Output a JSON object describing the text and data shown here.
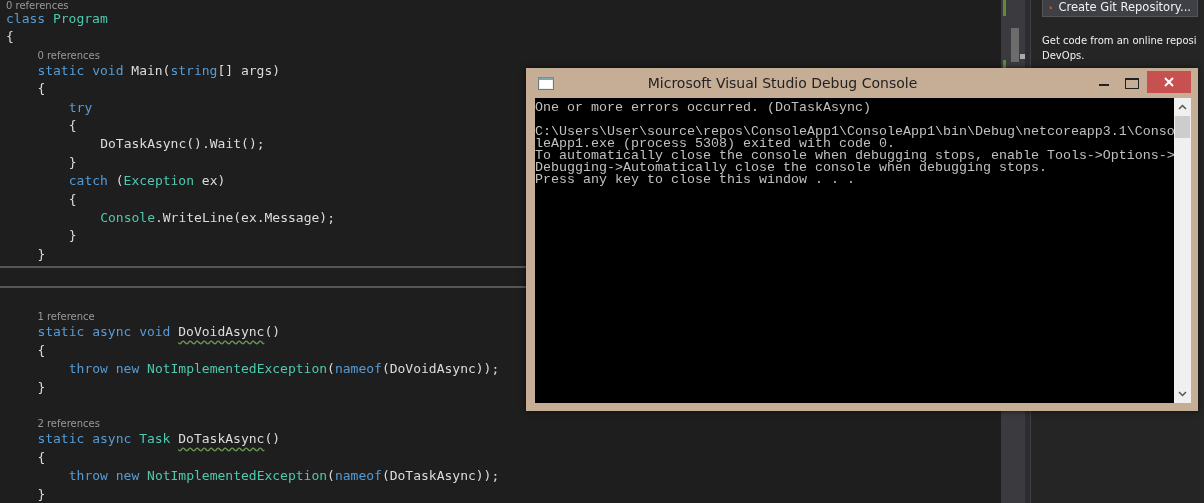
{
  "editor": {
    "lines": [
      {
        "kind": "lens",
        "text": "0 references"
      },
      {
        "kind": "code",
        "tokens": [
          {
            "kind": "kw",
            "text": "class "
          },
          {
            "kind": "type",
            "text": "Program"
          }
        ]
      },
      {
        "kind": "code",
        "tokens": [
          {
            "kind": "plain",
            "text": "{"
          }
        ]
      },
      {
        "kind": "block",
        "children": [
          {
            "kind": "lens",
            "text": "0 references"
          },
          {
            "kind": "code",
            "tokens": [
              {
                "kind": "kw",
                "text": "static void "
              },
              {
                "kind": "plain",
                "text": "Main("
              },
              {
                "kind": "kw",
                "text": "string"
              },
              {
                "kind": "plain",
                "text": "[] args)"
              }
            ]
          },
          {
            "kind": "code",
            "tokens": [
              {
                "kind": "plain",
                "text": "{"
              }
            ]
          },
          {
            "kind": "block",
            "children": [
              {
                "kind": "code",
                "tokens": [
                  {
                    "kind": "kw",
                    "text": "try"
                  }
                ]
              },
              {
                "kind": "code",
                "tokens": [
                  {
                    "kind": "plain",
                    "text": "{"
                  }
                ]
              },
              {
                "kind": "block",
                "children": [
                  {
                    "kind": "code",
                    "tokens": [
                      {
                        "kind": "plain",
                        "text": "DoTaskAsync().Wait();"
                      }
                    ]
                  }
                ]
              },
              {
                "kind": "code",
                "tokens": [
                  {
                    "kind": "plain",
                    "text": "}"
                  }
                ]
              },
              {
                "kind": "code",
                "tokens": [
                  {
                    "kind": "kw",
                    "text": "catch "
                  },
                  {
                    "kind": "plain",
                    "text": "("
                  },
                  {
                    "kind": "type",
                    "text": "Exception"
                  },
                  {
                    "kind": "plain",
                    "text": " ex)"
                  }
                ]
              },
              {
                "kind": "code",
                "tokens": [
                  {
                    "kind": "plain",
                    "text": "{"
                  }
                ]
              },
              {
                "kind": "block",
                "children": [
                  {
                    "kind": "code",
                    "tokens": [
                      {
                        "kind": "type",
                        "text": "Console"
                      },
                      {
                        "kind": "plain",
                        "text": ".WriteLine(ex.Message);"
                      }
                    ]
                  }
                ]
              },
              {
                "kind": "code",
                "tokens": [
                  {
                    "kind": "plain",
                    "text": "}"
                  }
                ]
              }
            ]
          },
          {
            "kind": "code",
            "tokens": [
              {
                "kind": "plain",
                "text": "}"
              }
            ]
          }
        ]
      },
      {
        "kind": "splitter"
      },
      {
        "kind": "blank"
      },
      {
        "kind": "block",
        "children": [
          {
            "kind": "lens",
            "text": "1 reference"
          },
          {
            "kind": "code",
            "tokens": [
              {
                "kind": "kw",
                "text": "static async void "
              },
              {
                "kind": "warn",
                "text": "DoVoidAsync"
              },
              {
                "kind": "plain",
                "text": "()"
              }
            ]
          },
          {
            "kind": "code",
            "tokens": [
              {
                "kind": "plain",
                "text": "{"
              }
            ]
          },
          {
            "kind": "block",
            "children": [
              {
                "kind": "code",
                "tokens": [
                  {
                    "kind": "kw",
                    "text": "throw new "
                  },
                  {
                    "kind": "type",
                    "text": "NotImplementedException"
                  },
                  {
                    "kind": "plain",
                    "text": "("
                  },
                  {
                    "kind": "kw",
                    "text": "nameof"
                  },
                  {
                    "kind": "plain",
                    "text": "(DoVoidAsync));"
                  }
                ]
              }
            ]
          },
          {
            "kind": "code",
            "tokens": [
              {
                "kind": "plain",
                "text": "}"
              }
            ]
          },
          {
            "kind": "blank"
          },
          {
            "kind": "lens",
            "text": "2 references"
          },
          {
            "kind": "code",
            "tokens": [
              {
                "kind": "kw",
                "text": "static async "
              },
              {
                "kind": "type",
                "text": "Task "
              },
              {
                "kind": "warn",
                "text": "DoTaskAsync"
              },
              {
                "kind": "plain",
                "text": "()"
              }
            ]
          },
          {
            "kind": "code",
            "tokens": [
              {
                "kind": "plain",
                "text": "{"
              }
            ]
          },
          {
            "kind": "block",
            "children": [
              {
                "kind": "code",
                "tokens": [
                  {
                    "kind": "kw",
                    "text": "throw new "
                  },
                  {
                    "kind": "type",
                    "text": "NotImplementedException"
                  },
                  {
                    "kind": "plain",
                    "text": "("
                  },
                  {
                    "kind": "kw",
                    "text": "nameof"
                  },
                  {
                    "kind": "plain",
                    "text": "(DoTaskAsync));"
                  }
                ]
              }
            ]
          },
          {
            "kind": "code",
            "tokens": [
              {
                "kind": "plain",
                "text": "}"
              }
            ]
          }
        ]
      }
    ]
  },
  "panel": {
    "button": "Create Git Repository...",
    "text_lines": [
      "Get code from an online reposi",
      "DevOps."
    ]
  },
  "console": {
    "title": "Microsoft Visual Studio Debug Console",
    "blocks": [
      [
        "One or more errors occurred. (DoTaskAsync)"
      ],
      [
        "C:\\Users\\User\\source\\repos\\ConsoleApp1\\ConsoleApp1\\bin\\Debug\\netcoreapp3.1\\Conso",
        "leApp1.exe (process 5308) exited with code 0.",
        "To automatically close the console when debugging stops, enable Tools->Options->",
        "Debugging->Automatically close the console when debugging stops.",
        "Press any key to close this window . . ."
      ]
    ]
  }
}
